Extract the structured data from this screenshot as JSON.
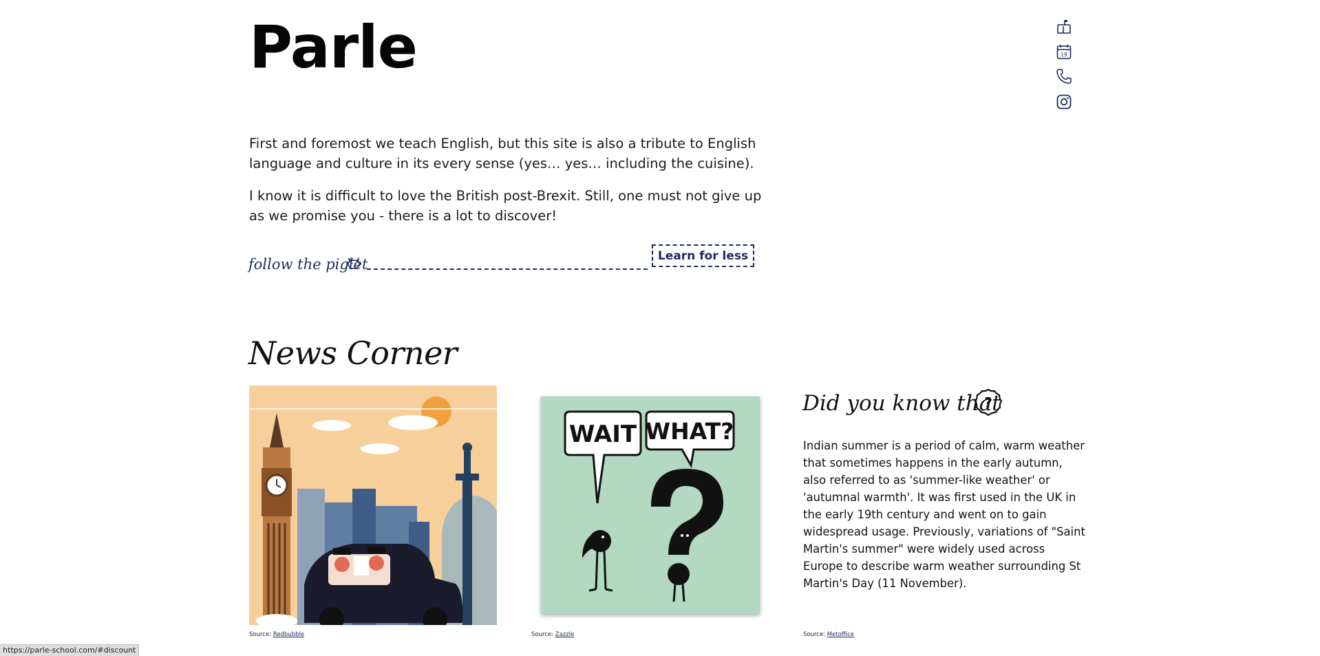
{
  "header": {
    "title": "Parle"
  },
  "intro": {
    "paragraph1": "First and foremost we teach English, but this site is also a tribute to English language and culture in its every sense (yes… yes… including the cuisine).",
    "paragraph2": "I know it is difficult to love the British post-Brexit. Still, one must not give up as we promise you - there is a lot to discover!"
  },
  "cta": {
    "follow_text": "follow the piglet",
    "button_label": "Learn for less"
  },
  "news": {
    "title": "News Corner",
    "card1": {
      "source_prefix": "Source: ",
      "source_link": "Redbubble"
    },
    "card2": {
      "bubble_left": "WAIT",
      "bubble_right": "WHAT?",
      "source_prefix": "Source: ",
      "source_link": "Zazzle"
    },
    "card3": {
      "title": "Did you know that",
      "text": "Indian summer is a period of calm, warm weather that sometimes happens in the early autumn, also referred to as 'summer-like weather' or 'autumnal warmth'. It was first used in the UK in the early 19th century and went on to gain widespread usage. Previously, variations of \"Saint Martin's summer\" were widely used across Europe to describe warm weather surrounding St Martin's Day (11 November).",
      "source_prefix": "Source: ",
      "source_link": "Metoffice"
    }
  },
  "sidebar": {
    "icons": [
      "mailbox-icon",
      "calendar-icon",
      "phone-icon",
      "instagram-icon"
    ],
    "calendar_day": "19"
  },
  "status_bar": {
    "url": "https://parle-school.com/#discount"
  },
  "colors": {
    "accent": "#1b2a5c",
    "text": "#111111",
    "background": "#ffffff"
  }
}
